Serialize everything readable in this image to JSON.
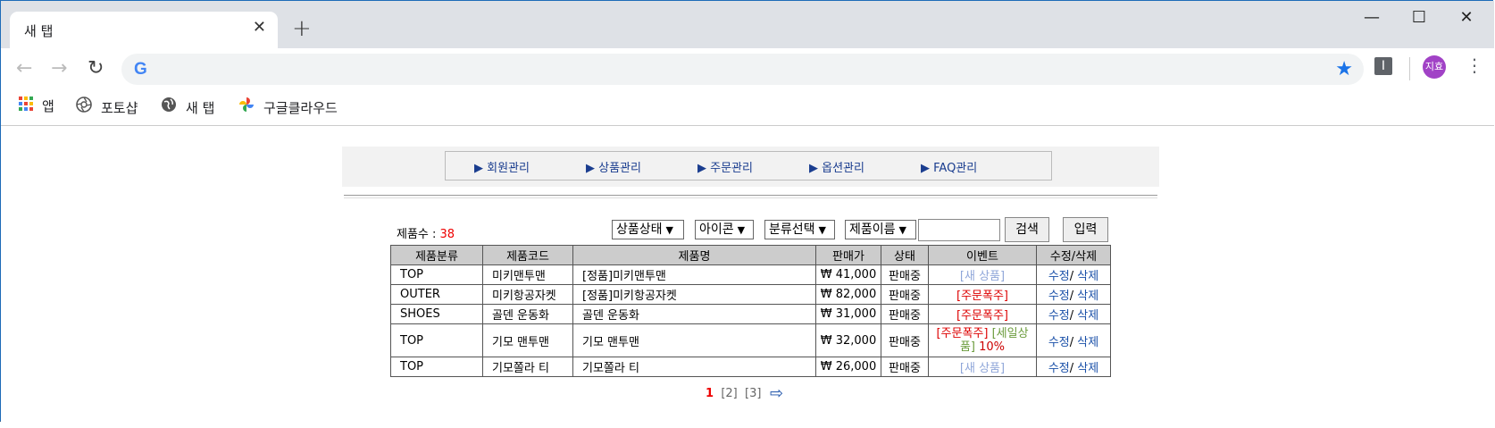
{
  "browser": {
    "tab_title": "새 탭",
    "tab_close": "✕",
    "new_tab": "+",
    "window_controls": {
      "minimize": "—",
      "maximize": "☐",
      "close": "✕"
    },
    "nav": {
      "back": "←",
      "forward": "→",
      "reload": "↻"
    },
    "google_logo": "G",
    "bookmark_star": "★",
    "extension_icon": "I",
    "avatar_text": "지효",
    "menu": "⋮",
    "bookmarks": [
      {
        "label": "앱",
        "icon": "apps-grid-icon"
      },
      {
        "label": "포토샵",
        "icon": "aperture-icon"
      },
      {
        "label": "새 탭",
        "icon": "globe-icon"
      },
      {
        "label": "구글클라우드",
        "icon": "pinwheel-icon"
      }
    ]
  },
  "admin_menu": {
    "items": [
      "▶ 회원관리",
      "▶ 상품관리",
      "▶ 주문관리",
      "▶ 옵션관리",
      "▶ FAQ관리"
    ]
  },
  "filters": {
    "count_label": "제품수 : ",
    "count_value": "38",
    "status_select": "상품상태",
    "icon_select": "아이콘",
    "category_select": "분류선택",
    "field_select": "제품이름",
    "search_value": "",
    "search_button": "검색",
    "input_button": "입력"
  },
  "table": {
    "headers": [
      "제품분류",
      "제품코드",
      "제품명",
      "판매가",
      "상태",
      "이벤트",
      "수정/삭제"
    ],
    "rows": [
      {
        "category": "TOP",
        "code": "미키맨투맨",
        "name": "[정품]미키맨투맨",
        "price": "₩ 41,000",
        "status": "판매중",
        "event_new": "[새 상품]",
        "event_hot": "",
        "event_sale": "",
        "event_pct": "",
        "edit": "수정",
        "sep": "/",
        "del": "삭제"
      },
      {
        "category": "OUTER",
        "code": "미키항공자켓",
        "name": "[정품]미키항공자켓",
        "price": "₩ 82,000",
        "status": "판매중",
        "event_new": "",
        "event_hot": "[주문폭주]",
        "event_sale": "",
        "event_pct": "",
        "edit": "수정",
        "sep": "/",
        "del": "삭제"
      },
      {
        "category": "SHOES",
        "code": "골덴 운동화",
        "name": "골덴 운동화",
        "price": "₩ 31,000",
        "status": "판매중",
        "event_new": "",
        "event_hot": "[주문폭주]",
        "event_sale": "",
        "event_pct": "",
        "edit": "수정",
        "sep": "/",
        "del": "삭제"
      },
      {
        "category": "TOP",
        "code": "기모 맨투맨",
        "name": "기모 맨투맨",
        "price": "₩ 32,000",
        "status": "판매중",
        "event_new": "",
        "event_hot": "[주문폭주]",
        "event_sale": "[세일상품]",
        "event_pct": "10%",
        "edit": "수정",
        "sep": "/",
        "del": "삭제"
      },
      {
        "category": "TOP",
        "code": "기모쫄라 티",
        "name": "기모쫄라 티",
        "price": "₩ 26,000",
        "status": "판매중",
        "event_new": "[새 상품]",
        "event_hot": "",
        "event_sale": "",
        "event_pct": "",
        "edit": "수정",
        "sep": "/",
        "del": "삭제"
      }
    ]
  },
  "pager": {
    "current": "1",
    "p2": "[2]",
    "p3": "[3]",
    "next": "⇨"
  }
}
